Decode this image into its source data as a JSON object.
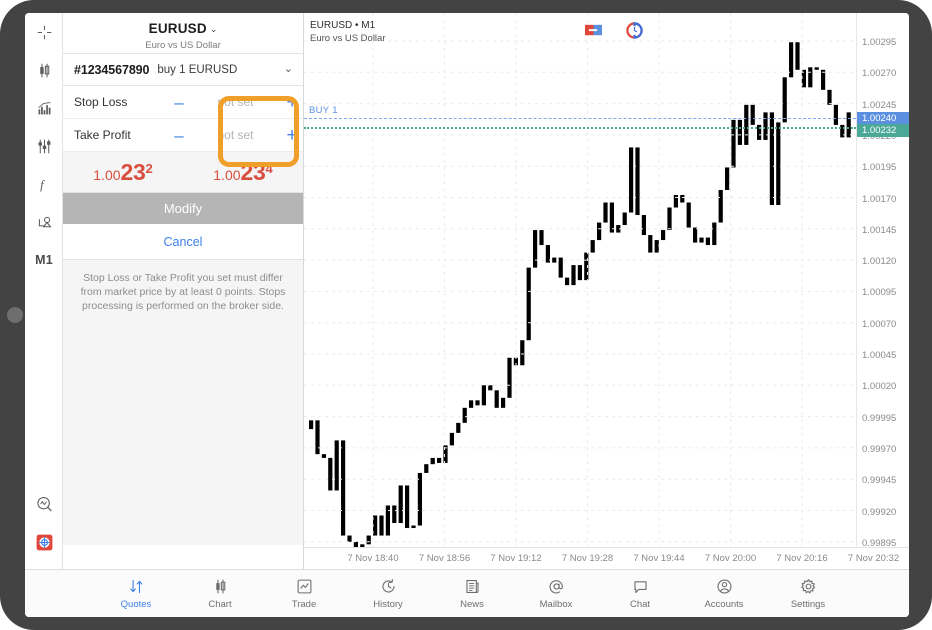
{
  "device": {
    "home_button": "home-button"
  },
  "tool_rail": {
    "items": [
      {
        "name": "crosshair-icon",
        "label": "crosshair"
      },
      {
        "name": "chart-type-icon",
        "label": "chart type"
      },
      {
        "name": "indicators-icon",
        "label": "indicators"
      },
      {
        "name": "settings-sliders-icon",
        "label": "sliders"
      },
      {
        "name": "function-icon",
        "label": "f"
      },
      {
        "name": "objects-icon",
        "label": "objects"
      }
    ],
    "timeframe": "M1",
    "bottom_items": [
      {
        "name": "search-chart-icon",
        "label": "scan"
      },
      {
        "name": "crosshair-target-icon",
        "label": "target"
      }
    ]
  },
  "order_panel": {
    "symbol": "EURUSD",
    "symbol_caret": "⌄",
    "symbol_description": "Euro vs US Dollar",
    "order_id": "#1234567890",
    "order_description": "buy 1 EURUSD",
    "order_chevron": "⌄",
    "rows": [
      {
        "label": "Stop Loss",
        "minus": "–",
        "value": "not set",
        "plus": "+"
      },
      {
        "label": "Take Profit",
        "minus": "–",
        "value": "not set",
        "plus": "+"
      }
    ],
    "highlight_color": "#f0a02a",
    "prices": [
      {
        "prefix": "1.00",
        "big": "23",
        "sup": "2"
      },
      {
        "prefix": "1.00",
        "big": "23",
        "sup": "4"
      }
    ],
    "price_color": "#d94f3d",
    "modify_label": "Modify",
    "cancel_label": "Cancel",
    "hint": "Stop Loss or Take Profit you set must differ from market price by at least 0 points. Stops processing is performed on the broker side."
  },
  "chart": {
    "title": "EURUSD • M1",
    "subtitle": "Euro vs US Dollar",
    "buy_label": "BUY 1",
    "buy_line_color": "#5b8fe0",
    "bid_line_color": "#49a896",
    "badges": [
      "position-marker-icon",
      "clock-marker-icon"
    ],
    "price_axis": {
      "ticks": [
        "1.00295",
        "1.00270",
        "1.00245",
        "1.00220",
        "1.00195",
        "1.00170",
        "1.00145",
        "1.00120",
        "1.00095",
        "1.00070",
        "1.00045",
        "1.00020",
        "0.99995",
        "0.99970",
        "0.99945",
        "0.99920",
        "0.99895"
      ],
      "chip_buy": "1.00240",
      "chip_bid": "1.00232"
    },
    "time_axis": {
      "ticks": [
        "7 Nov 18:40",
        "7 Nov 18:56",
        "7 Nov 19:12",
        "7 Nov 19:28",
        "7 Nov 19:44",
        "7 Nov 20:00",
        "7 Nov 20:16",
        "7 Nov 20:32"
      ]
    },
    "candle_up_color": "#3e9c8a",
    "candle_down_color": "#e05c4c"
  },
  "bottom_nav": {
    "items": [
      {
        "label": "Quotes",
        "icon": "quotes-arrows-icon",
        "active": true
      },
      {
        "label": "Chart",
        "icon": "chart-candles-icon",
        "active": false
      },
      {
        "label": "Trade",
        "icon": "trade-line-icon",
        "active": false
      },
      {
        "label": "History",
        "icon": "history-clock-icon",
        "active": false
      },
      {
        "label": "News",
        "icon": "news-paper-icon",
        "active": false
      },
      {
        "label": "Mailbox",
        "icon": "mailbox-at-icon",
        "active": false
      },
      {
        "label": "Chat",
        "icon": "chat-bubble-icon",
        "active": false
      },
      {
        "label": "Accounts",
        "icon": "accounts-person-icon",
        "active": false
      },
      {
        "label": "Settings",
        "icon": "settings-gear-icon",
        "active": false
      }
    ]
  },
  "chart_data": {
    "type": "candlestick",
    "title": "EURUSD • M1",
    "xlabel": "",
    "ylabel": "",
    "ylim": [
      0.99883,
      1.00307
    ],
    "xticks": [
      "7 Nov 18:40",
      "7 Nov 18:56",
      "7 Nov 19:12",
      "7 Nov 19:28",
      "7 Nov 19:44",
      "7 Nov 20:00",
      "7 Nov 20:16",
      "7 Nov 20:32"
    ],
    "yticks": [
      "1.00295",
      "1.00270",
      "1.00245",
      "1.00220",
      "1.00195",
      "1.00170",
      "1.00145",
      "1.00120",
      "1.00095",
      "1.00070",
      "1.00045",
      "1.00020",
      "0.99995",
      "0.99970",
      "0.99945",
      "0.99920",
      "0.99895"
    ],
    "annotations": [
      {
        "label": "BUY 1",
        "price": "1.00240",
        "style": "dashed",
        "color": "#5b8fe0"
      },
      {
        "label": "",
        "price": "1.00232",
        "style": "dotted",
        "color": "#49a896"
      }
    ],
    "candles": [
      {
        "o": 0.99985,
        "h": 1.0,
        "l": 0.99978,
        "c": 0.99992
      },
      {
        "o": 0.99992,
        "h": 1.00004,
        "l": 0.9996,
        "c": 0.99965
      },
      {
        "o": 0.99965,
        "h": 0.99968,
        "l": 0.9994,
        "c": 0.99962
      },
      {
        "o": 0.99962,
        "h": 0.99975,
        "l": 0.9993,
        "c": 0.99936
      },
      {
        "o": 0.99936,
        "h": 0.9998,
        "l": 0.99934,
        "c": 0.99976
      },
      {
        "o": 0.99976,
        "h": 0.99982,
        "l": 0.99896,
        "c": 0.999
      },
      {
        "o": 0.999,
        "h": 0.99906,
        "l": 0.99888,
        "c": 0.99895
      },
      {
        "o": 0.99895,
        "h": 0.99898,
        "l": 0.9988,
        "c": 0.99884
      },
      {
        "o": 0.99884,
        "h": 0.99896,
        "l": 0.9988,
        "c": 0.99893
      },
      {
        "o": 0.99893,
        "h": 0.99904,
        "l": 0.9989,
        "c": 0.999
      },
      {
        "o": 0.999,
        "h": 0.9992,
        "l": 0.99898,
        "c": 0.99916
      },
      {
        "o": 0.99916,
        "h": 0.9992,
        "l": 0.99896,
        "c": 0.999
      },
      {
        "o": 0.999,
        "h": 0.9993,
        "l": 0.99898,
        "c": 0.99924
      },
      {
        "o": 0.99924,
        "h": 0.99934,
        "l": 0.99906,
        "c": 0.9991
      },
      {
        "o": 0.9991,
        "h": 0.99944,
        "l": 0.99906,
        "c": 0.9994
      },
      {
        "o": 0.9994,
        "h": 0.99944,
        "l": 0.999,
        "c": 0.99906
      },
      {
        "o": 0.99906,
        "h": 0.99912,
        "l": 0.999,
        "c": 0.99908
      },
      {
        "o": 0.99908,
        "h": 0.99955,
        "l": 0.99904,
        "c": 0.9995
      },
      {
        "o": 0.9995,
        "h": 0.9996,
        "l": 0.99938,
        "c": 0.99957
      },
      {
        "o": 0.99957,
        "h": 0.99966,
        "l": 0.99952,
        "c": 0.99962
      },
      {
        "o": 0.99962,
        "h": 0.9997,
        "l": 0.9994,
        "c": 0.99958
      },
      {
        "o": 0.99958,
        "h": 0.99976,
        "l": 0.99955,
        "c": 0.99972
      },
      {
        "o": 0.99972,
        "h": 0.99986,
        "l": 0.99968,
        "c": 0.99982
      },
      {
        "o": 0.99982,
        "h": 0.99996,
        "l": 0.99978,
        "c": 0.9999
      },
      {
        "o": 0.9999,
        "h": 1.00006,
        "l": 0.99984,
        "c": 1.00002
      },
      {
        "o": 1.00002,
        "h": 1.00012,
        "l": 0.99994,
        "c": 1.00008
      },
      {
        "o": 1.00008,
        "h": 1.00018,
        "l": 1.0,
        "c": 1.00004
      },
      {
        "o": 1.00004,
        "h": 1.00024,
        "l": 1.0,
        "c": 1.0002
      },
      {
        "o": 1.0002,
        "h": 1.00036,
        "l": 1.00012,
        "c": 1.00016
      },
      {
        "o": 1.00016,
        "h": 1.00026,
        "l": 0.99998,
        "c": 1.00002
      },
      {
        "o": 1.00002,
        "h": 1.00014,
        "l": 0.99996,
        "c": 1.0001
      },
      {
        "o": 1.0001,
        "h": 1.00048,
        "l": 1.00006,
        "c": 1.00042
      },
      {
        "o": 1.00042,
        "h": 1.00052,
        "l": 1.0003,
        "c": 1.00036
      },
      {
        "o": 1.00036,
        "h": 1.00062,
        "l": 1.00032,
        "c": 1.00056
      },
      {
        "o": 1.00056,
        "h": 1.0012,
        "l": 1.0005,
        "c": 1.00114
      },
      {
        "o": 1.00114,
        "h": 1.0015,
        "l": 1.00108,
        "c": 1.00144
      },
      {
        "o": 1.00144,
        "h": 1.00152,
        "l": 1.00126,
        "c": 1.00132
      },
      {
        "o": 1.00132,
        "h": 1.0014,
        "l": 1.00112,
        "c": 1.00118
      },
      {
        "o": 1.00118,
        "h": 1.00126,
        "l": 1.00102,
        "c": 1.00122
      },
      {
        "o": 1.00122,
        "h": 1.00134,
        "l": 1.001,
        "c": 1.00106
      },
      {
        "o": 1.00106,
        "h": 1.00118,
        "l": 1.00094,
        "c": 1.001
      },
      {
        "o": 1.001,
        "h": 1.0012,
        "l": 1.00096,
        "c": 1.00116
      },
      {
        "o": 1.00116,
        "h": 1.00124,
        "l": 1.00098,
        "c": 1.00104
      },
      {
        "o": 1.00104,
        "h": 1.0013,
        "l": 1.001,
        "c": 1.00126
      },
      {
        "o": 1.00126,
        "h": 1.00142,
        "l": 1.0012,
        "c": 1.00136
      },
      {
        "o": 1.00136,
        "h": 1.00156,
        "l": 1.00128,
        "c": 1.0015
      },
      {
        "o": 1.0015,
        "h": 1.00172,
        "l": 1.00144,
        "c": 1.00166
      },
      {
        "o": 1.00166,
        "h": 1.0017,
        "l": 1.00136,
        "c": 1.00142
      },
      {
        "o": 1.00142,
        "h": 1.00152,
        "l": 1.00134,
        "c": 1.00148
      },
      {
        "o": 1.00148,
        "h": 1.00164,
        "l": 1.00142,
        "c": 1.00158
      },
      {
        "o": 1.00158,
        "h": 1.00216,
        "l": 1.00152,
        "c": 1.0021
      },
      {
        "o": 1.0021,
        "h": 1.0022,
        "l": 1.0015,
        "c": 1.00156
      },
      {
        "o": 1.00156,
        "h": 1.00162,
        "l": 1.00136,
        "c": 1.0014
      },
      {
        "o": 1.0014,
        "h": 1.00146,
        "l": 1.00122,
        "c": 1.00126
      },
      {
        "o": 1.00126,
        "h": 1.0014,
        "l": 1.00118,
        "c": 1.00136
      },
      {
        "o": 1.00136,
        "h": 1.0015,
        "l": 1.0013,
        "c": 1.00144
      },
      {
        "o": 1.00144,
        "h": 1.00168,
        "l": 1.0014,
        "c": 1.00162
      },
      {
        "o": 1.00162,
        "h": 1.00178,
        "l": 1.00156,
        "c": 1.00172
      },
      {
        "o": 1.00172,
        "h": 1.0019,
        "l": 1.0016,
        "c": 1.00166
      },
      {
        "o": 1.00166,
        "h": 1.00174,
        "l": 1.0014,
        "c": 1.00146
      },
      {
        "o": 1.00146,
        "h": 1.00154,
        "l": 1.00128,
        "c": 1.00134
      },
      {
        "o": 1.00134,
        "h": 1.00142,
        "l": 1.00114,
        "c": 1.00138
      },
      {
        "o": 1.00138,
        "h": 1.00144,
        "l": 1.00126,
        "c": 1.00132
      },
      {
        "o": 1.00132,
        "h": 1.00156,
        "l": 1.00128,
        "c": 1.0015
      },
      {
        "o": 1.0015,
        "h": 1.0018,
        "l": 1.00146,
        "c": 1.00176
      },
      {
        "o": 1.00176,
        "h": 1.002,
        "l": 1.0017,
        "c": 1.00194
      },
      {
        "o": 1.00194,
        "h": 1.00238,
        "l": 1.0019,
        "c": 1.00232
      },
      {
        "o": 1.00232,
        "h": 1.0024,
        "l": 1.00206,
        "c": 1.00212
      },
      {
        "o": 1.00212,
        "h": 1.0025,
        "l": 1.00208,
        "c": 1.00244
      },
      {
        "o": 1.00244,
        "h": 1.00252,
        "l": 1.00222,
        "c": 1.00228
      },
      {
        "o": 1.00228,
        "h": 1.00236,
        "l": 1.0021,
        "c": 1.00216
      },
      {
        "o": 1.00216,
        "h": 1.00244,
        "l": 1.00212,
        "c": 1.00238
      },
      {
        "o": 1.00238,
        "h": 1.00246,
        "l": 1.00158,
        "c": 1.00164
      },
      {
        "o": 1.00164,
        "h": 1.00236,
        "l": 1.0016,
        "c": 1.0023
      },
      {
        "o": 1.0023,
        "h": 1.00272,
        "l": 1.00226,
        "c": 1.00266
      },
      {
        "o": 1.00266,
        "h": 1.003,
        "l": 1.0026,
        "c": 1.00294
      },
      {
        "o": 1.00294,
        "h": 1.00302,
        "l": 1.00266,
        "c": 1.00272
      },
      {
        "o": 1.00272,
        "h": 1.0028,
        "l": 1.00252,
        "c": 1.00258
      },
      {
        "o": 1.00258,
        "h": 1.00278,
        "l": 1.00254,
        "c": 1.00274
      },
      {
        "o": 1.00274,
        "h": 1.00288,
        "l": 1.00268,
        "c": 1.00272
      },
      {
        "o": 1.00272,
        "h": 1.0028,
        "l": 1.0025,
        "c": 1.00256
      },
      {
        "o": 1.00256,
        "h": 1.00262,
        "l": 1.00238,
        "c": 1.00244
      },
      {
        "o": 1.00244,
        "h": 1.0025,
        "l": 1.00222,
        "c": 1.00228
      },
      {
        "o": 1.00228,
        "h": 1.00236,
        "l": 1.00212,
        "c": 1.00218
      },
      {
        "o": 1.00218,
        "h": 1.00244,
        "l": 1.00212,
        "c": 1.00238
      }
    ]
  }
}
